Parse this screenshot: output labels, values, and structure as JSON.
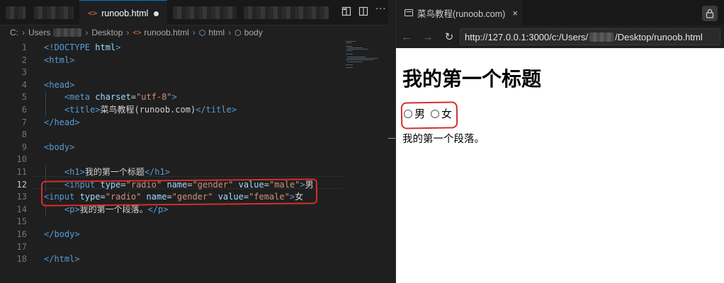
{
  "editor": {
    "active_tab": {
      "label": "runoob.html",
      "icon": "html-file-icon"
    },
    "tab_actions": [
      "split-preview-icon",
      "split-editor-icon",
      "more-icon"
    ],
    "breadcrumb": [
      "C:",
      "Users",
      "Desktop",
      "runoob.html",
      "html",
      "body"
    ],
    "active_line": 12,
    "line_numbers": [
      "1",
      "2",
      "3",
      "4",
      "5",
      "6",
      "7",
      "8",
      "9",
      "10",
      "11",
      "12",
      "13",
      "14",
      "15",
      "16",
      "17",
      "18"
    ],
    "lines": [
      [
        {
          "t": "tag",
          "v": "<!DOCTYPE "
        },
        {
          "t": "attr",
          "v": "html"
        },
        {
          "t": "tag",
          "v": ">"
        }
      ],
      [
        {
          "t": "tag",
          "v": "<html>"
        }
      ],
      [],
      [
        {
          "t": "tag",
          "v": "<head>"
        }
      ],
      [
        {
          "t": "txt",
          "v": "    "
        },
        {
          "t": "tag",
          "v": "<meta "
        },
        {
          "t": "attr",
          "v": "charset"
        },
        {
          "t": "txt",
          "v": "="
        },
        {
          "t": "str",
          "v": "\"utf-8\""
        },
        {
          "t": "tag",
          "v": ">"
        }
      ],
      [
        {
          "t": "txt",
          "v": "    "
        },
        {
          "t": "tag",
          "v": "<title>"
        },
        {
          "t": "txt",
          "v": "菜鸟教程(runoob.com)"
        },
        {
          "t": "tag",
          "v": "</title>"
        }
      ],
      [
        {
          "t": "tag",
          "v": "</head>"
        }
      ],
      [],
      [
        {
          "t": "tag",
          "v": "<body>"
        }
      ],
      [],
      [
        {
          "t": "txt",
          "v": "    "
        },
        {
          "t": "tag",
          "v": "<h1>"
        },
        {
          "t": "txt",
          "v": "我的第一个标题"
        },
        {
          "t": "tag",
          "v": "</h1>"
        }
      ],
      [
        {
          "t": "txt",
          "v": "    "
        },
        {
          "t": "tag",
          "v": "<input "
        },
        {
          "t": "attr",
          "v": "type"
        },
        {
          "t": "txt",
          "v": "="
        },
        {
          "t": "str",
          "v": "\"radio\""
        },
        {
          "t": "txt",
          "v": " "
        },
        {
          "t": "attr",
          "v": "name"
        },
        {
          "t": "txt",
          "v": "="
        },
        {
          "t": "str",
          "v": "\"gender\""
        },
        {
          "t": "txt",
          "v": " "
        },
        {
          "t": "attr",
          "v": "value"
        },
        {
          "t": "txt",
          "v": "="
        },
        {
          "t": "str",
          "v": "\"male\""
        },
        {
          "t": "tag",
          "v": ">"
        },
        {
          "t": "txt",
          "v": "男"
        }
      ],
      [
        {
          "t": "tag",
          "v": "<input "
        },
        {
          "t": "attr",
          "v": "type"
        },
        {
          "t": "txt",
          "v": "="
        },
        {
          "t": "str",
          "v": "\"radio\""
        },
        {
          "t": "txt",
          "v": " "
        },
        {
          "t": "attr",
          "v": "name"
        },
        {
          "t": "txt",
          "v": "="
        },
        {
          "t": "str",
          "v": "\"gender\""
        },
        {
          "t": "txt",
          "v": " "
        },
        {
          "t": "attr",
          "v": "value"
        },
        {
          "t": "txt",
          "v": "="
        },
        {
          "t": "str",
          "v": "\"female\""
        },
        {
          "t": "tag",
          "v": ">"
        },
        {
          "t": "txt",
          "v": "女"
        }
      ],
      [
        {
          "t": "txt",
          "v": "    "
        },
        {
          "t": "tag",
          "v": "<p>"
        },
        {
          "t": "txt",
          "v": "我的第一个段落。"
        },
        {
          "t": "tag",
          "v": "</p>"
        }
      ],
      [],
      [
        {
          "t": "tag",
          "v": "</body>"
        }
      ],
      [],
      [
        {
          "t": "tag",
          "v": "</html>"
        }
      ]
    ]
  },
  "preview": {
    "tab_title": "菜鸟教程(runoob.com)",
    "tab_icon": "browser-tab-icon",
    "close_icon": "×",
    "lock_icon": "lock-icon",
    "nav": {
      "back": "←",
      "forward": "→",
      "reload": "↻"
    },
    "url_prefix": "http://127.0.0.1:3000/c:/Users/",
    "url_suffix": "/Desktop/runoob.html",
    "page": {
      "heading": "我的第一个标题",
      "radios": [
        {
          "label": "男"
        },
        {
          "label": "女"
        }
      ],
      "paragraph": "我的第一个段落。"
    }
  },
  "colors": {
    "annotation_red": "#d32f2f",
    "tag": "#569cd6",
    "attr": "#9cdcfe",
    "string": "#ce9178",
    "accent": "#0078d4"
  }
}
